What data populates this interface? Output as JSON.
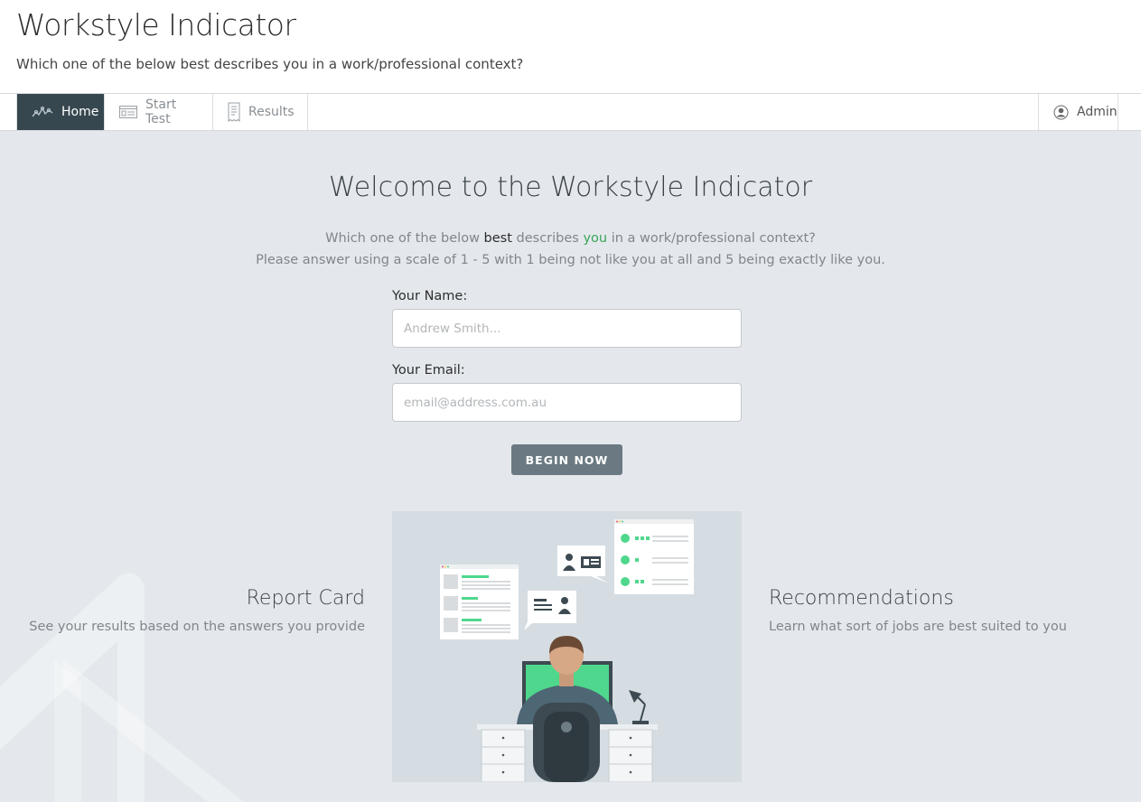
{
  "header": {
    "title": "Workstyle Indicator",
    "subtitle": "Which one of the below best describes you in a work/professional context?"
  },
  "nav": {
    "items": [
      {
        "label": "Home",
        "icon": "activity-icon",
        "active": true
      },
      {
        "label": "Start Test",
        "icon": "form-icon",
        "active": false
      },
      {
        "label": "Results",
        "icon": "receipt-icon",
        "active": false
      }
    ],
    "admin": {
      "label": "Admin",
      "icon": "user-circle-icon"
    }
  },
  "welcome": {
    "title": "Welcome to the Workstyle Indicator",
    "line1_pre": "Which one of the below ",
    "line1_best": "best",
    "line1_mid": " describes ",
    "line1_you": "you",
    "line1_post": " in a work/professional context?",
    "line2": "Please answer using a scale of 1 - 5 with 1 being not like you at all and 5 being exactly like you."
  },
  "form": {
    "name_label": "Your Name:",
    "name_placeholder": "Andrew Smith...",
    "name_value": "",
    "email_label": "Your Email:",
    "email_placeholder": "email@address.com.au",
    "email_value": "",
    "submit_label": "BEGIN NOW"
  },
  "features": {
    "left": {
      "title": "Report Card",
      "desc": "See your results based on the answers you provide"
    },
    "right": {
      "title": "Recommendations",
      "desc": "Learn what sort of jobs are best suited to you"
    }
  },
  "colors": {
    "nav_active": "#36474f",
    "accent_green": "#3aa55a",
    "button": "#6b7a82",
    "page_bg": "#e4e8ec"
  }
}
